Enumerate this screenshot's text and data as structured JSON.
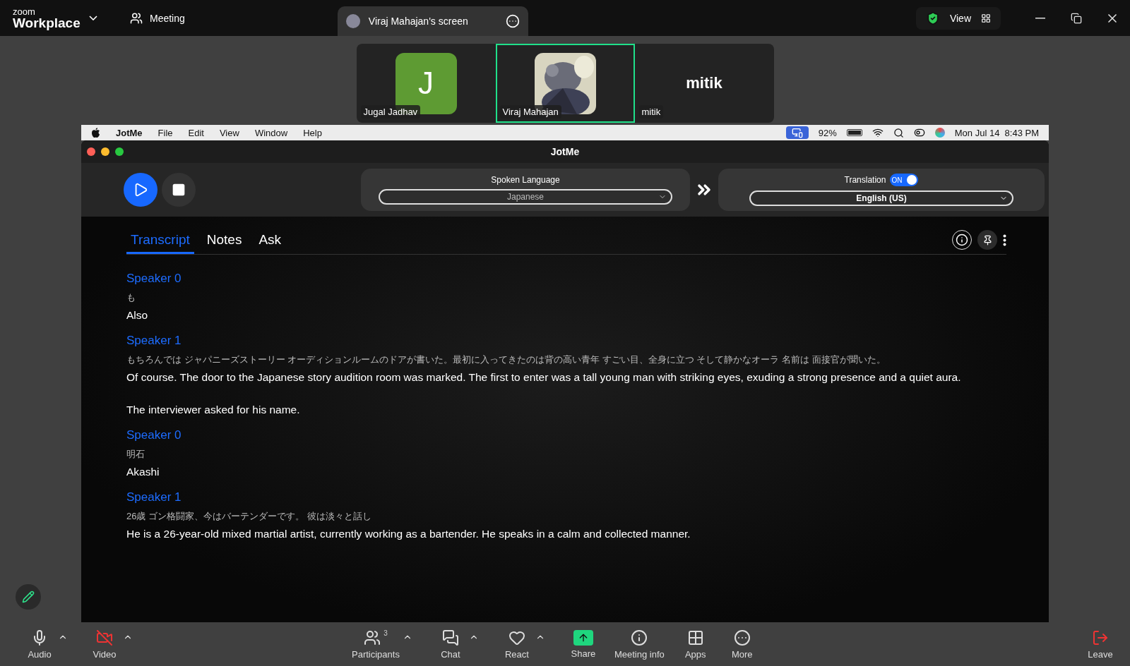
{
  "zoom_bar": {
    "logo_small": "zoom",
    "logo_large": "Workplace",
    "meeting_label": "Meeting",
    "share_tab": "Viraj Mahajan's screen",
    "view_button": "View"
  },
  "participants": [
    {
      "name": "Jugal Jadhav",
      "kind": "initial",
      "initial": "J",
      "color": "#5e9b33",
      "selected": false
    },
    {
      "name": "Viraj Mahajan",
      "kind": "picture",
      "selected": true
    },
    {
      "name": "mitik",
      "kind": "text",
      "display": "mitik",
      "selected": false
    }
  ],
  "mac_menu": {
    "app": "JotMe",
    "items": [
      "File",
      "Edit",
      "View",
      "Window",
      "Help"
    ],
    "battery": "92%",
    "clock": "Mon Jul 14  8:43 PM"
  },
  "window": {
    "title": "JotMe"
  },
  "controls": {
    "spoken_language": {
      "label": "Spoken Language",
      "value": "Japanese"
    },
    "translation": {
      "label": "Translation",
      "on": true,
      "switch_text": "ON",
      "value": "English (US)"
    }
  },
  "tabs": [
    {
      "label": "Transcript",
      "selected": true
    },
    {
      "label": "Notes",
      "selected": false
    },
    {
      "label": "Ask",
      "selected": false
    }
  ],
  "transcript": [
    {
      "speaker": "Speaker 0",
      "original": "も",
      "translation": [
        "Also"
      ]
    },
    {
      "speaker": "Speaker 1",
      "original": "もちろんでは ジャパニーズストーリー オーディションルームのドアが書いた。最初に入ってきたのは背の高い青年 すごい目、全身に立つ そして静かなオーラ 名前は 面接官が聞いた。",
      "translation": [
        "Of course. The door to the Japanese story audition room was marked. The first to enter was a tall young man with striking eyes, exuding a strong presence and a quiet aura.",
        "The interviewer asked for his name."
      ]
    },
    {
      "speaker": "Speaker 0",
      "original": "明石",
      "translation": [
        "Akashi"
      ]
    },
    {
      "speaker": "Speaker 1",
      "original": "26歳 ゴン格闘家、今はバーテンダーです。 彼は淡々と話し",
      "translation": [
        "He is a 26-year-old mixed martial artist, currently working as a bartender. He speaks in a calm and collected manner."
      ]
    }
  ],
  "toolbar": {
    "left": [
      {
        "label": "Audio",
        "off": false,
        "menu": true
      },
      {
        "label": "Video",
        "off": true,
        "menu": true
      }
    ],
    "center": [
      {
        "label": "Participants",
        "count": "3",
        "menu": true
      },
      {
        "label": "Chat",
        "menu": true
      },
      {
        "label": "React",
        "menu": true
      },
      {
        "label": "Share"
      },
      {
        "label": "Meeting info"
      },
      {
        "label": "Apps"
      },
      {
        "label": "More"
      }
    ],
    "leave": "Leave"
  }
}
